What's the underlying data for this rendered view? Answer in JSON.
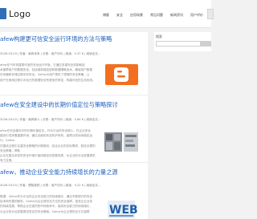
{
  "header": {
    "logo_text": "Logo",
    "nav": [
      "博客",
      "安全",
      "应用场景",
      "常见问题",
      "新闻资讯",
      "用户评价",
      "友"
    ]
  },
  "sidebar": {
    "search_label": "搜索"
  },
  "articles": [
    {
      "title": "afew构建更可信安全运行环境的方法与策略",
      "meta": "2026-03-03 | 作者：南风未来 | 分类：用户评价 | 阅读：5.37 K | 阅读全文...",
      "excerpt_lines": [
        "afew在汽车构建更可信的安全运行环境，它通过多重安全机制和技",
        "术保障用户的数据安全，包括端到端加密和数据隔离技术，确保用户数据",
        "在传输和存储过程中的安全。Safew为用户提供了透明的安全策略，让",
        "用户在使用过程中对自己的数据安全有更多的掌控，构建可信的生态系统。"
      ],
      "thumb": "blogger-logo"
    },
    {
      "title": "afew在安全建设中的长期价值定位与策略探讨",
      "meta": "2026-03-03 | 作者：南风驿人 | 分类：用户评价 | 阅读：4.84 K | 阅读全文...",
      "excerpt_lines": [
        "afew在安全建设中的长期价值定位，作为平台的安全核心，在企业安全",
        "建设中发挥着重要作用，通过全面的安全防护体系，保障业务持续稳定运行。Safew",
        "在建设过程中注重安全策略的长期规划，结合企业的实际需求，制定合理的安全策略，帮助",
        "企业在复杂多变的安全环境中保持稳定的发展态势，为企业的长远发展提供有力支撑。"
      ],
      "thumb": "grid-photo"
    },
    {
      "title": "afew，推动企业安全能力持续增长的力量之源",
      "meta": "2026-03-03 | 作者：理智彼阳 | 分类：用户评价 | 阅读：3.22 K | 阅读全文...",
      "excerpt_lines": [
        "数据：Safew作为平台的企业安全能力的持续增长，通过不断提升的安全",
        "技术和完善的服务，Safew为企业提供全方位的安全保障，促进企业业务",
        "的持续发展，帮助企业在激烈的市场竞争中，保持安全能力的持续增长，",
        "为企业的长远发展提供坚实的安全基础。Safew为企业提供全方位保障"
      ],
      "thumb": "web-graphic"
    }
  ],
  "thumb_colors": {
    "blogger_bg": "#f26f21",
    "web_text": "#1f5fa8"
  }
}
